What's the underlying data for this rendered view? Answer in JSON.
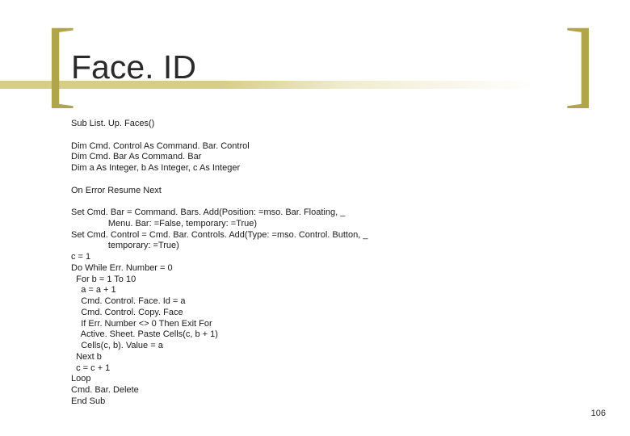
{
  "title": "Face. ID",
  "page_number": "106",
  "code": "Sub List. Up. Faces()\n\nDim Cmd. Control As Command. Bar. Control\nDim Cmd. Bar As Command. Bar\nDim a As Integer, b As Integer, c As Integer\n\nOn Error Resume Next\n\nSet Cmd. Bar = Command. Bars. Add(Position: =mso. Bar. Floating, _\n               Menu. Bar: =False, temporary: =True)\nSet Cmd. Control = Cmd. Bar. Controls. Add(Type: =mso. Control. Button, _\n               temporary: =True)\nc = 1\nDo While Err. Number = 0\n  For b = 1 To 10\n    a = a + 1\n    Cmd. Control. Face. Id = a\n    Cmd. Control. Copy. Face\n    If Err. Number <> 0 Then Exit For\n    Active. Sheet. Paste Cells(c, b + 1)\n    Cells(c, b). Value = a\n  Next b\n  c = c + 1\nLoop\nCmd. Bar. Delete\nEnd Sub"
}
